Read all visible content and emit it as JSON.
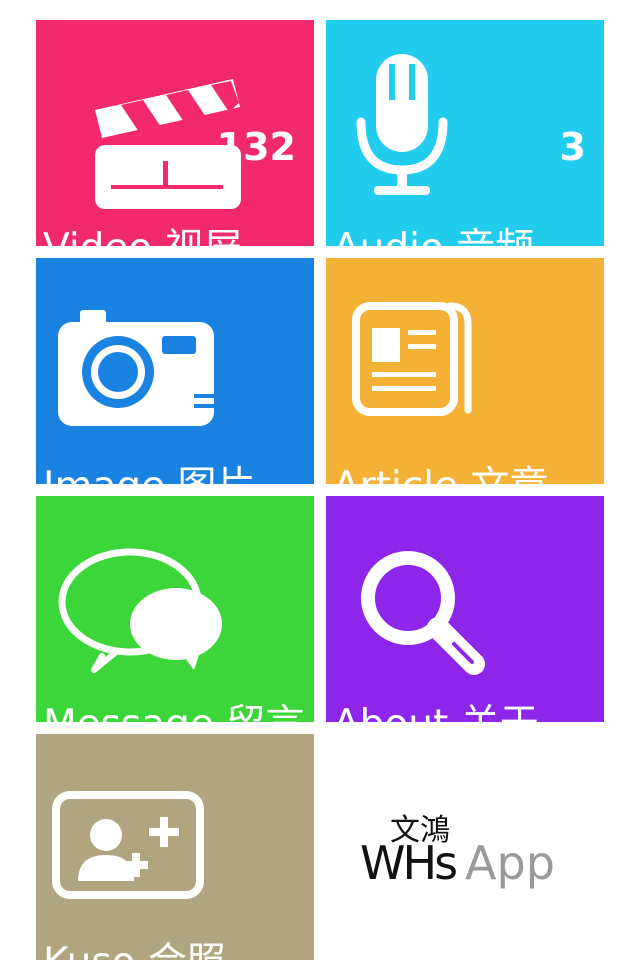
{
  "tiles": [
    {
      "id": "video",
      "label": "Video 视屏",
      "count": "132",
      "color": "#f2296d",
      "icon": "clapperboard-icon"
    },
    {
      "id": "audio",
      "label": "Audio 音频",
      "count": "3",
      "color": "#22ccee",
      "icon": "microphone-icon"
    },
    {
      "id": "image",
      "label": "Image 图片",
      "color": "#1a82e0",
      "icon": "camera-icon"
    },
    {
      "id": "article",
      "label": "Article 文章",
      "color": "#f3b136",
      "icon": "newspaper-icon"
    },
    {
      "id": "message",
      "label": "Message 留言",
      "color": "#3cd53a",
      "icon": "speech-bubbles-icon"
    },
    {
      "id": "about",
      "label": "About 关于",
      "color": "#8d25eb",
      "icon": "magnifier-icon"
    },
    {
      "id": "kuso",
      "label": "Kuso 合照",
      "color": "#b0a57f",
      "icon": "add-person-photo-icon"
    }
  ],
  "logo": {
    "brand": "WHs",
    "app": "App",
    "chinese": "文鴻"
  }
}
